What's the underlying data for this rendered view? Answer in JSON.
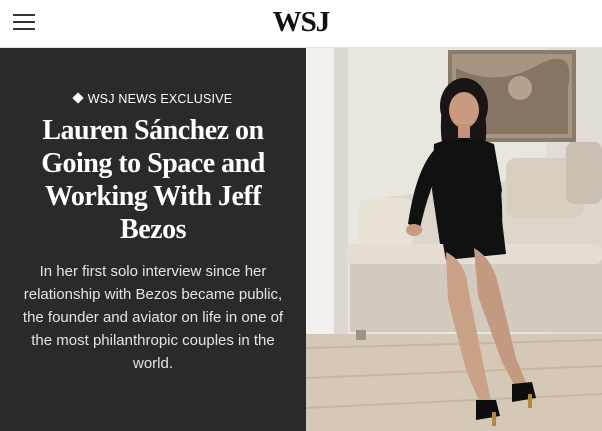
{
  "header": {
    "logo": "WSJ",
    "menu_icon": "hamburger-menu-icon"
  },
  "hero": {
    "kicker": "WSJ NEWS EXCLUSIVE",
    "kicker_icon": "diamond-icon",
    "headline": "Lauren Sánchez on Going to Space and Working With Jeff Bezos",
    "dek": "In her first solo interview since her relationship with Bezos became public, the founder and aviator on life in one of the most philanthropic couples in the world."
  },
  "colors": {
    "panel_background": "#2a2a2a",
    "panel_text": "#ffffff",
    "header_background": "#ffffff"
  }
}
